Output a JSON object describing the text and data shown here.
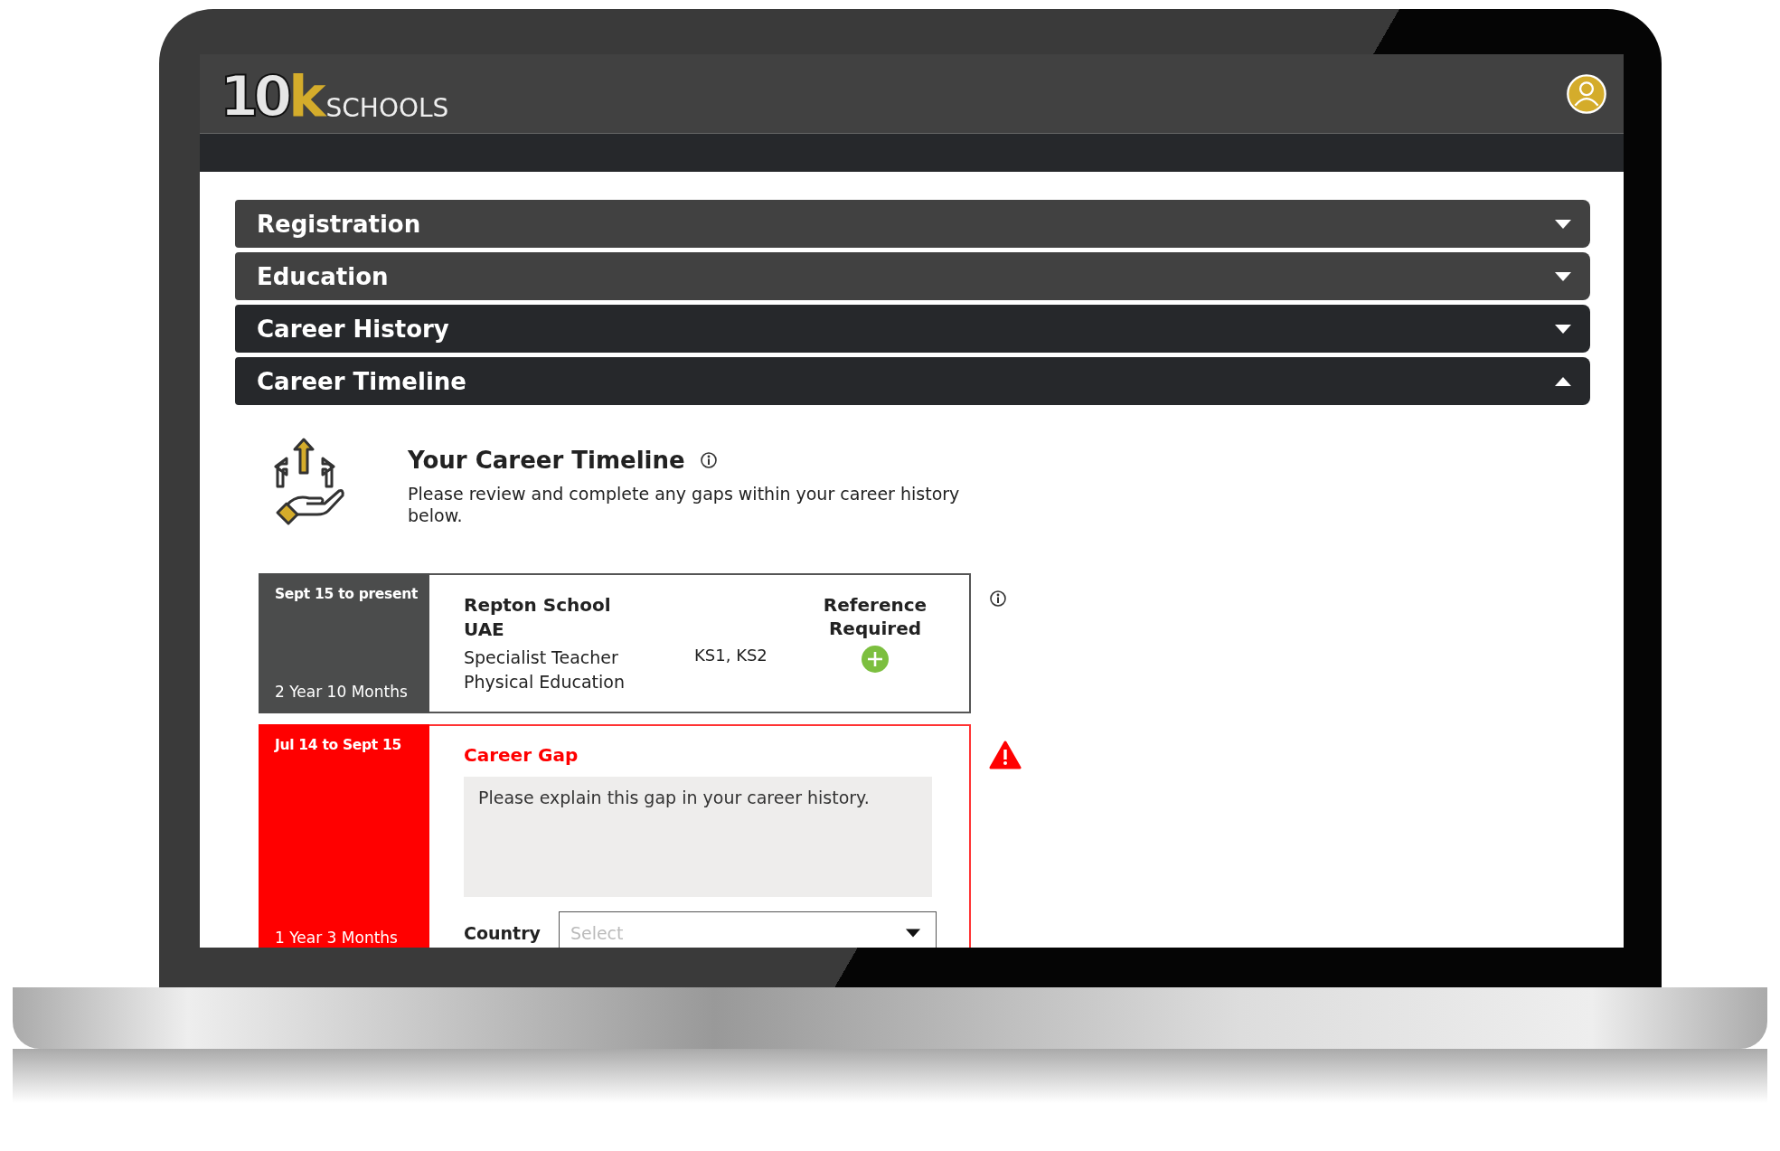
{
  "header": {
    "logo_numerals": "10",
    "logo_letter": "k",
    "logo_word": "SCHOOLS"
  },
  "sections": [
    {
      "title": "Registration",
      "expanded": false
    },
    {
      "title": "Education",
      "expanded": false
    },
    {
      "title": "Career History",
      "expanded": false
    },
    {
      "title": "Career Timeline",
      "expanded": true
    }
  ],
  "intro": {
    "title": "Your Career Timeline",
    "description": "Please review and complete any gaps within your career history below."
  },
  "timeline": [
    {
      "kind": "job",
      "date_range": "Sept 15 to present",
      "duration": "2 Year 10 Months",
      "school": "Repton School",
      "location": "UAE",
      "role": "Specialist Teacher",
      "subject": "Physical Education",
      "key_stages": "KS1, KS2",
      "reference_label": "Reference Required"
    },
    {
      "kind": "gap",
      "date_range": "Jul 14 to Sept 15",
      "duration": "1 Year 3 Months",
      "title": "Career Gap",
      "placeholder": "Please explain this gap in your career history.",
      "country_label": "Country",
      "country_placeholder": "Select"
    }
  ]
}
